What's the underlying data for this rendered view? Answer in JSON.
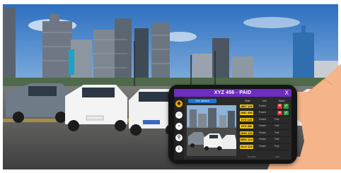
{
  "app": {
    "title": "XYZ 456 - PAID",
    "close_glyph": "X"
  },
  "sidebar": {
    "items": [
      {
        "icon": "camera-icon",
        "glyph": "◉",
        "active": true
      },
      {
        "icon": "home-icon",
        "glyph": "⌂",
        "active": false
      },
      {
        "icon": "car-icon",
        "glyph": "▪",
        "active": false
      },
      {
        "icon": "search-icon",
        "glyph": "⚲",
        "active": false
      },
      {
        "icon": "info-icon",
        "glyph": "i",
        "active": false
      }
    ]
  },
  "camera_button": {
    "label": "Live camera"
  },
  "plates": {
    "headers": [
      "Plate",
      "Info",
      "Status"
    ],
    "rows": [
      {
        "plate": "ABC 123",
        "info": "Parked",
        "status": "",
        "marks": [
          "no",
          "yes"
        ]
      },
      {
        "plate": "DBC 456",
        "info": "Parked",
        "status": "",
        "marks": [
          "no",
          "yes"
        ]
      },
      {
        "plate": "XYZ 123",
        "info": "Parked",
        "status": "Paid",
        "marks": []
      },
      {
        "plate": "XYZ 456",
        "info": "Parked",
        "status": "Paid",
        "marks": []
      },
      {
        "plate": "HHO 123",
        "info": "Parked",
        "status": "Paid",
        "marks": []
      },
      {
        "plate": "BBO 123",
        "info": "Parked",
        "status": "Paid",
        "marks": []
      },
      {
        "plate": "OLO 123",
        "info": "Parked",
        "status": "Paid",
        "marks": []
      }
    ],
    "footer": [
      "Previous",
      "Next"
    ]
  },
  "colors": {
    "title_bar": "#6e2cc2",
    "plate": "#f2c40f",
    "accept": "#2f9e44",
    "reject": "#d8342c",
    "active_icon": "#f2a900"
  }
}
